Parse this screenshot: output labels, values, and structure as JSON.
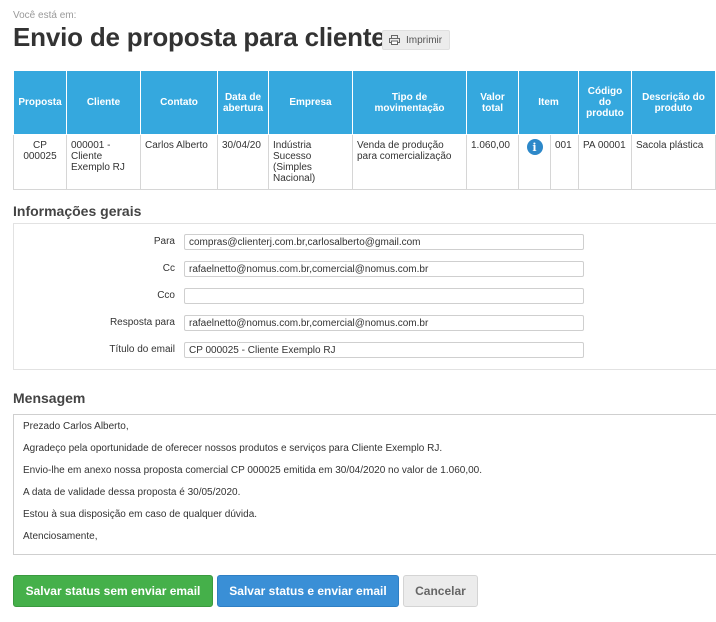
{
  "breadcrumb": "Você está em:",
  "page_title": "Envio de proposta para cliente",
  "print_label": "Imprimir",
  "table": {
    "headers": [
      "Proposta",
      "Cliente",
      "Contato",
      "Data de abertura",
      "Empresa",
      "Tipo de movimentação",
      "Valor total",
      "Item",
      "",
      "Código do produto",
      "Descrição do produto"
    ],
    "row": {
      "proposta": "CP 000025",
      "cliente": "000001 - Cliente Exemplo RJ",
      "contato": "Carlos Alberto",
      "data_abertura": "30/04/20",
      "empresa": "Indústria Sucesso (Simples Nacional)",
      "tipo_movimentacao": "Venda de produção para comercialização",
      "valor_total": "1.060,00",
      "item": "001",
      "codigo_produto": "PA 00001",
      "descricao_produto": "Sacola plástica"
    }
  },
  "info_section": {
    "title": "Informações gerais",
    "fields": {
      "para": {
        "label": "Para",
        "value": "compras@clienterj.com.br,carlosalberto@gmail.com"
      },
      "cc": {
        "label": "Cc",
        "value": "rafaelnetto@nomus.com.br,comercial@nomus.com.br"
      },
      "cco": {
        "label": "Cco",
        "value": ""
      },
      "resposta": {
        "label": "Resposta para",
        "value": "rafaelnetto@nomus.com.br,comercial@nomus.com.br"
      },
      "titulo": {
        "label": "Título do email",
        "value": "CP 000025 - Cliente Exemplo RJ"
      }
    }
  },
  "message_section": {
    "title": "Mensagem",
    "lines": [
      "Prezado Carlos Alberto,",
      "Agradeço pela oportunidade de oferecer nossos produtos e serviços para Cliente Exemplo RJ.",
      "Envio-lhe em anexo nossa proposta comercial CP 000025 emitida em 30/04/2020 no valor de 1.060,00.",
      "A data de validade dessa proposta é 30/05/2020.",
      "Estou à sua disposição em caso de qualquer dúvida.",
      "Atenciosamente,"
    ]
  },
  "buttons": {
    "save_no_email": "Salvar status sem enviar email",
    "save_send_email": "Salvar status e enviar email",
    "cancel": "Cancelar"
  },
  "colors": {
    "table_header": "#35a8de",
    "green_button": "#45b04a",
    "blue_button": "#3a8fd6",
    "info_icon": "#2d88c9"
  },
  "icons": {
    "print": "printer-icon",
    "info": "info-icon"
  }
}
